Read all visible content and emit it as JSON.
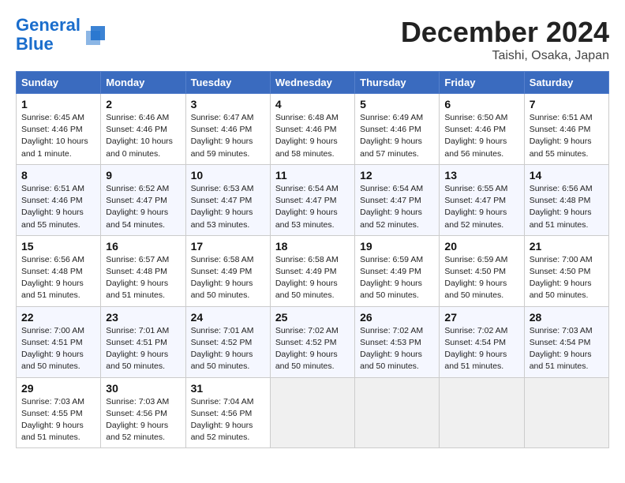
{
  "header": {
    "logo_line1": "General",
    "logo_line2": "Blue",
    "month": "December 2024",
    "location": "Taishi, Osaka, Japan"
  },
  "days_of_week": [
    "Sunday",
    "Monday",
    "Tuesday",
    "Wednesday",
    "Thursday",
    "Friday",
    "Saturday"
  ],
  "weeks": [
    [
      {
        "day": "1",
        "info": "Sunrise: 6:45 AM\nSunset: 4:46 PM\nDaylight: 10 hours\nand 1 minute."
      },
      {
        "day": "2",
        "info": "Sunrise: 6:46 AM\nSunset: 4:46 PM\nDaylight: 10 hours\nand 0 minutes."
      },
      {
        "day": "3",
        "info": "Sunrise: 6:47 AM\nSunset: 4:46 PM\nDaylight: 9 hours\nand 59 minutes."
      },
      {
        "day": "4",
        "info": "Sunrise: 6:48 AM\nSunset: 4:46 PM\nDaylight: 9 hours\nand 58 minutes."
      },
      {
        "day": "5",
        "info": "Sunrise: 6:49 AM\nSunset: 4:46 PM\nDaylight: 9 hours\nand 57 minutes."
      },
      {
        "day": "6",
        "info": "Sunrise: 6:50 AM\nSunset: 4:46 PM\nDaylight: 9 hours\nand 56 minutes."
      },
      {
        "day": "7",
        "info": "Sunrise: 6:51 AM\nSunset: 4:46 PM\nDaylight: 9 hours\nand 55 minutes."
      }
    ],
    [
      {
        "day": "8",
        "info": "Sunrise: 6:51 AM\nSunset: 4:46 PM\nDaylight: 9 hours\nand 55 minutes."
      },
      {
        "day": "9",
        "info": "Sunrise: 6:52 AM\nSunset: 4:47 PM\nDaylight: 9 hours\nand 54 minutes."
      },
      {
        "day": "10",
        "info": "Sunrise: 6:53 AM\nSunset: 4:47 PM\nDaylight: 9 hours\nand 53 minutes."
      },
      {
        "day": "11",
        "info": "Sunrise: 6:54 AM\nSunset: 4:47 PM\nDaylight: 9 hours\nand 53 minutes."
      },
      {
        "day": "12",
        "info": "Sunrise: 6:54 AM\nSunset: 4:47 PM\nDaylight: 9 hours\nand 52 minutes."
      },
      {
        "day": "13",
        "info": "Sunrise: 6:55 AM\nSunset: 4:47 PM\nDaylight: 9 hours\nand 52 minutes."
      },
      {
        "day": "14",
        "info": "Sunrise: 6:56 AM\nSunset: 4:48 PM\nDaylight: 9 hours\nand 51 minutes."
      }
    ],
    [
      {
        "day": "15",
        "info": "Sunrise: 6:56 AM\nSunset: 4:48 PM\nDaylight: 9 hours\nand 51 minutes."
      },
      {
        "day": "16",
        "info": "Sunrise: 6:57 AM\nSunset: 4:48 PM\nDaylight: 9 hours\nand 51 minutes."
      },
      {
        "day": "17",
        "info": "Sunrise: 6:58 AM\nSunset: 4:49 PM\nDaylight: 9 hours\nand 50 minutes."
      },
      {
        "day": "18",
        "info": "Sunrise: 6:58 AM\nSunset: 4:49 PM\nDaylight: 9 hours\nand 50 minutes."
      },
      {
        "day": "19",
        "info": "Sunrise: 6:59 AM\nSunset: 4:49 PM\nDaylight: 9 hours\nand 50 minutes."
      },
      {
        "day": "20",
        "info": "Sunrise: 6:59 AM\nSunset: 4:50 PM\nDaylight: 9 hours\nand 50 minutes."
      },
      {
        "day": "21",
        "info": "Sunrise: 7:00 AM\nSunset: 4:50 PM\nDaylight: 9 hours\nand 50 minutes."
      }
    ],
    [
      {
        "day": "22",
        "info": "Sunrise: 7:00 AM\nSunset: 4:51 PM\nDaylight: 9 hours\nand 50 minutes."
      },
      {
        "day": "23",
        "info": "Sunrise: 7:01 AM\nSunset: 4:51 PM\nDaylight: 9 hours\nand 50 minutes."
      },
      {
        "day": "24",
        "info": "Sunrise: 7:01 AM\nSunset: 4:52 PM\nDaylight: 9 hours\nand 50 minutes."
      },
      {
        "day": "25",
        "info": "Sunrise: 7:02 AM\nSunset: 4:52 PM\nDaylight: 9 hours\nand 50 minutes."
      },
      {
        "day": "26",
        "info": "Sunrise: 7:02 AM\nSunset: 4:53 PM\nDaylight: 9 hours\nand 50 minutes."
      },
      {
        "day": "27",
        "info": "Sunrise: 7:02 AM\nSunset: 4:54 PM\nDaylight: 9 hours\nand 51 minutes."
      },
      {
        "day": "28",
        "info": "Sunrise: 7:03 AM\nSunset: 4:54 PM\nDaylight: 9 hours\nand 51 minutes."
      }
    ],
    [
      {
        "day": "29",
        "info": "Sunrise: 7:03 AM\nSunset: 4:55 PM\nDaylight: 9 hours\nand 51 minutes."
      },
      {
        "day": "30",
        "info": "Sunrise: 7:03 AM\nSunset: 4:56 PM\nDaylight: 9 hours\nand 52 minutes."
      },
      {
        "day": "31",
        "info": "Sunrise: 7:04 AM\nSunset: 4:56 PM\nDaylight: 9 hours\nand 52 minutes."
      },
      null,
      null,
      null,
      null
    ]
  ]
}
